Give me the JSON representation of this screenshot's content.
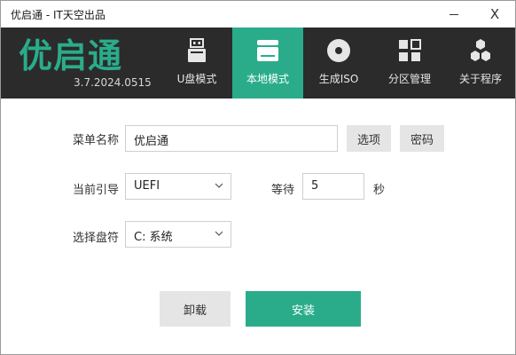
{
  "window": {
    "title": "优启通 - IT天空出品",
    "minimize_icon": "minimize-icon",
    "close_label": "X"
  },
  "header": {
    "logo_text": "优启通",
    "version": "3.7.2024.0515",
    "tabs": [
      {
        "label": "U盘模式",
        "icon": "usb-drive-icon",
        "active": false
      },
      {
        "label": "本地模式",
        "icon": "hard-disk-icon",
        "active": true
      },
      {
        "label": "生成ISO",
        "icon": "disc-icon",
        "active": false
      },
      {
        "label": "分区管理",
        "icon": "partition-grid-icon",
        "active": false
      },
      {
        "label": "关于程序",
        "icon": "hexagons-icon",
        "active": false
      }
    ]
  },
  "form": {
    "menu_name_label": "菜单名称",
    "menu_name_value": "优启通",
    "options_button": "选项",
    "password_button": "密码",
    "boot_label": "当前引导",
    "boot_value": "UEFI",
    "wait_label": "等待",
    "wait_value": "5",
    "seconds_label": "秒",
    "disk_label": "选择盘符",
    "disk_value": "C: 系统"
  },
  "actions": {
    "uninstall": "卸载",
    "install": "安装"
  },
  "colors": {
    "accent": "#2aac8b",
    "header_bg": "#2b2b2b"
  }
}
